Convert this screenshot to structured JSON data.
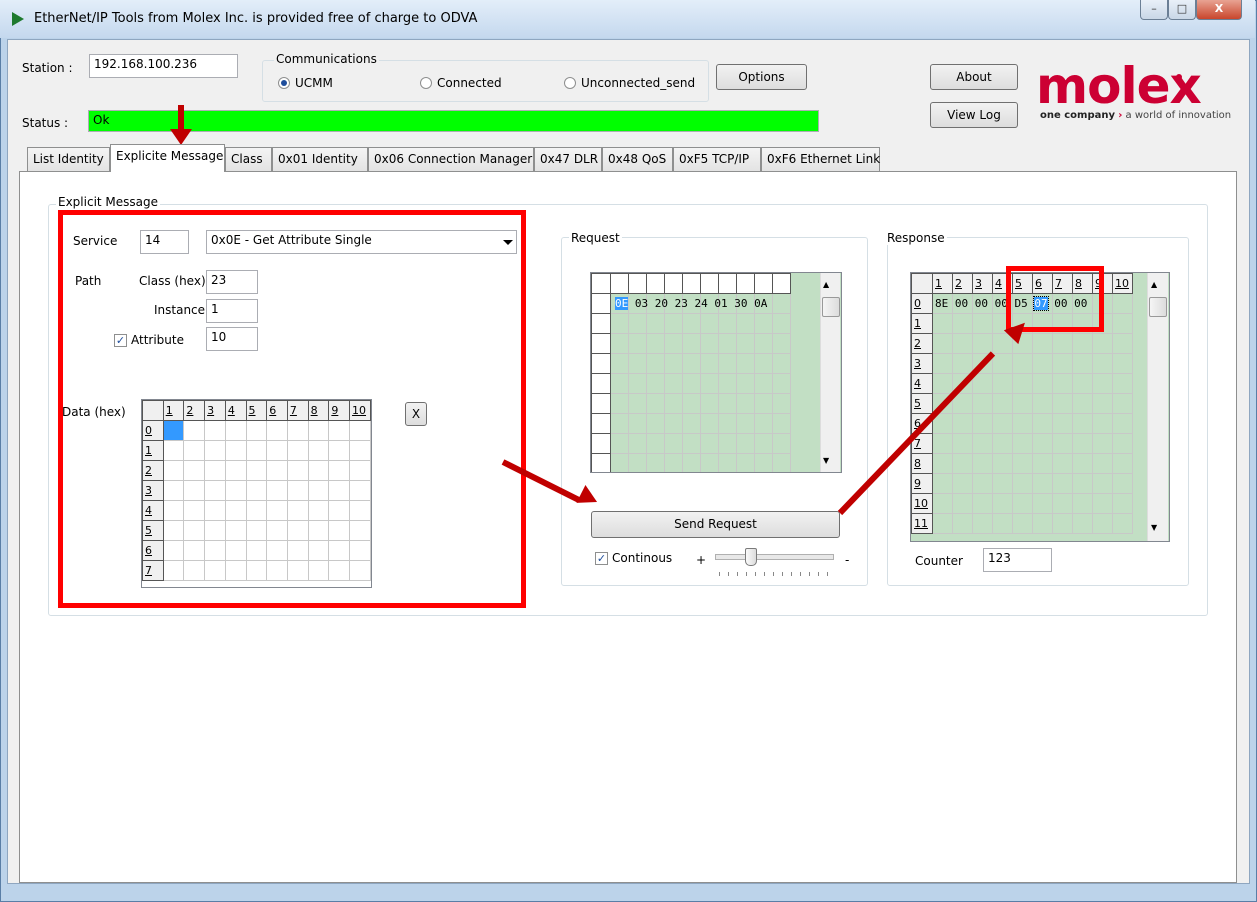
{
  "window": {
    "title": "EtherNet/IP Tools from Molex Inc. is provided free of charge to ODVA",
    "minimize_glyph": "–",
    "maximize_glyph": "□",
    "close_glyph": "X"
  },
  "header": {
    "station_label": "Station :",
    "station_value": "192.168.100.236",
    "communications_label": "Communications",
    "radio_ucmm": "UCMM",
    "radio_connected": "Connected",
    "radio_unconnected": "Unconnected_send",
    "options_label": "Options",
    "about_label": "About",
    "viewlog_label": "View Log",
    "status_label": "Status :",
    "status_value": "Ok",
    "status_color": "#00ff00"
  },
  "logo": {
    "wordmark": "molex",
    "tagline_bold": "one company",
    "tagline_rest": "a world of innovation",
    "brand_color": "#cc0033"
  },
  "tabs": [
    {
      "label": "List Identity"
    },
    {
      "label": "Explicite Message"
    },
    {
      "label": "Class"
    },
    {
      "label": "0x01 Identity"
    },
    {
      "label": "0x06 Connection Manager"
    },
    {
      "label": "0x47 DLR"
    },
    {
      "label": "0x48 QoS"
    },
    {
      "label": "0xF5 TCP/IP"
    },
    {
      "label": "0xF6 Ethernet Link"
    }
  ],
  "explicit": {
    "group_label": "Explicit Message",
    "service_label": "Service",
    "service_value": "14",
    "service_selected": "0x0E - Get Attribute Single",
    "path_label": "Path",
    "class_label": "Class (hex)",
    "class_value": "23",
    "instance_label": "Instance",
    "instance_value": "1",
    "attribute_label": "Attribute",
    "attribute_value": "10",
    "attribute_checked": true,
    "data_label": "Data (hex)",
    "clear_button": "X",
    "col_headers": [
      "1",
      "2",
      "3",
      "4",
      "5",
      "6",
      "7",
      "8",
      "9",
      "10"
    ],
    "row_headers": [
      "0",
      "1",
      "2",
      "3",
      "4",
      "5",
      "6",
      "7"
    ]
  },
  "request": {
    "group_label": "Request",
    "row0": "0E 03 20 23 24 01 30 0A",
    "selected_byte": "0E",
    "send_button": "Send Request",
    "continuous_label": "Continous",
    "continuous_checked": true,
    "plus_label": "+",
    "minus_label": "-",
    "speed_slider_fraction": 0.28
  },
  "response": {
    "group_label": "Response",
    "col_headers": [
      "1",
      "2",
      "3",
      "4",
      "5",
      "6",
      "7",
      "8",
      "9",
      "10"
    ],
    "row_headers": [
      "0",
      "1",
      "2",
      "3",
      "4",
      "5",
      "6",
      "7",
      "8",
      "9",
      "10",
      "11"
    ],
    "row0": "8E 00 00 00 D5 07 00 00",
    "selected_byte": "07",
    "counter_label": "Counter",
    "counter_value": "123"
  },
  "annotation_color": "#c00000",
  "highlight_color": "#ff0000"
}
